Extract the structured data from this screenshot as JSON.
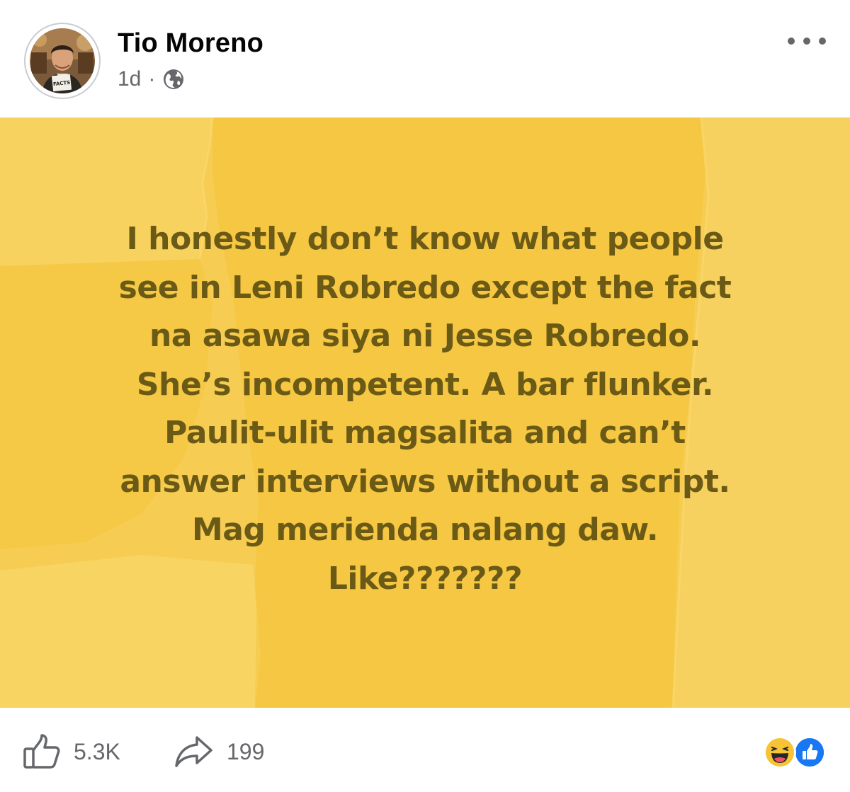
{
  "post": {
    "author": "Tio Moreno",
    "time": "1d",
    "separator": "·",
    "privacy_icon": "globe-icon",
    "avatar_badge": "FACTS",
    "more_icon": "more-options-icon"
  },
  "card": {
    "background_color": "#f6cc52",
    "text_color": "#6b5a16",
    "lines": [
      "I honestly don’t know what people",
      "see in Leni Robredo except the fact",
      "na asawa siya ni Jesse Robredo.",
      "She’s incompetent. A bar flunker.",
      "Paulit-ulit magsalita and can’t",
      "answer interviews without a script.",
      "Mag merienda nalang daw.",
      "Like???????"
    ]
  },
  "footer": {
    "likes": "5.3K",
    "shares": "199",
    "like_icon": "thumbs-up-icon",
    "share_icon": "share-arrow-icon",
    "reactions": [
      "haha-reaction-icon",
      "like-reaction-icon"
    ]
  }
}
